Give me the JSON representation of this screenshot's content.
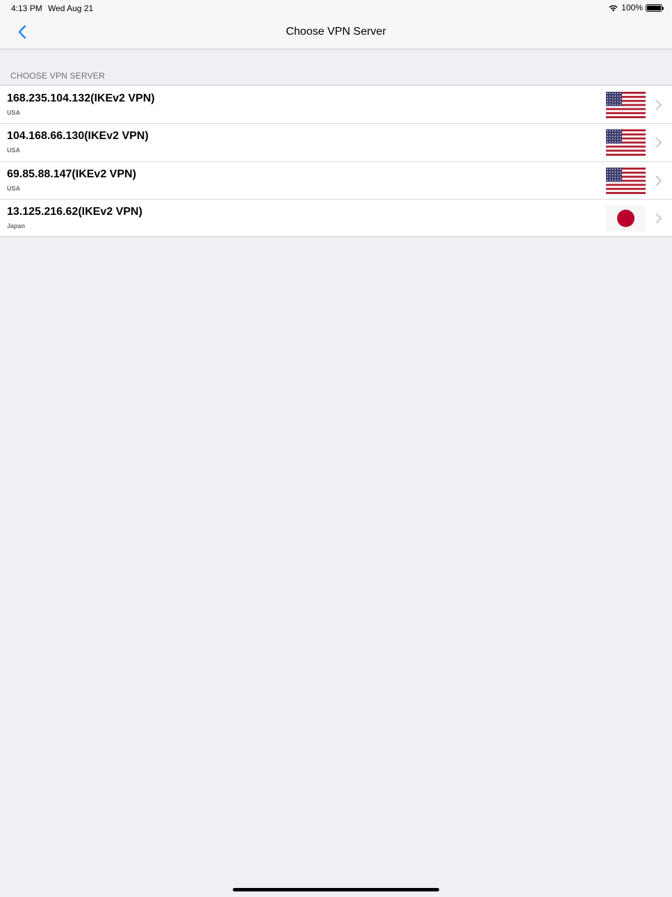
{
  "status_bar": {
    "time": "4:13 PM",
    "date": "Wed Aug 21",
    "battery": "100%"
  },
  "nav": {
    "title": "Choose VPN Server",
    "back_icon": "chevron-left-icon"
  },
  "section_header": "CHOOSE VPN SERVER",
  "servers": [
    {
      "address": "168.235.104.132(IKEv2 VPN)",
      "country": "USA",
      "flag": "us"
    },
    {
      "address": "104.168.66.130(IKEv2 VPN)",
      "country": "USA",
      "flag": "us"
    },
    {
      "address": "69.85.88.147(IKEv2 VPN)",
      "country": "USA",
      "flag": "us"
    },
    {
      "address": "13.125.216.62(IKEv2 VPN)",
      "country": "Japan",
      "flag": "jp"
    }
  ],
  "colors": {
    "accent": "#007aff",
    "background": "#efeff4",
    "us_red": "#b22234",
    "us_blue": "#3c3b6e",
    "jp_red": "#bc002d"
  }
}
